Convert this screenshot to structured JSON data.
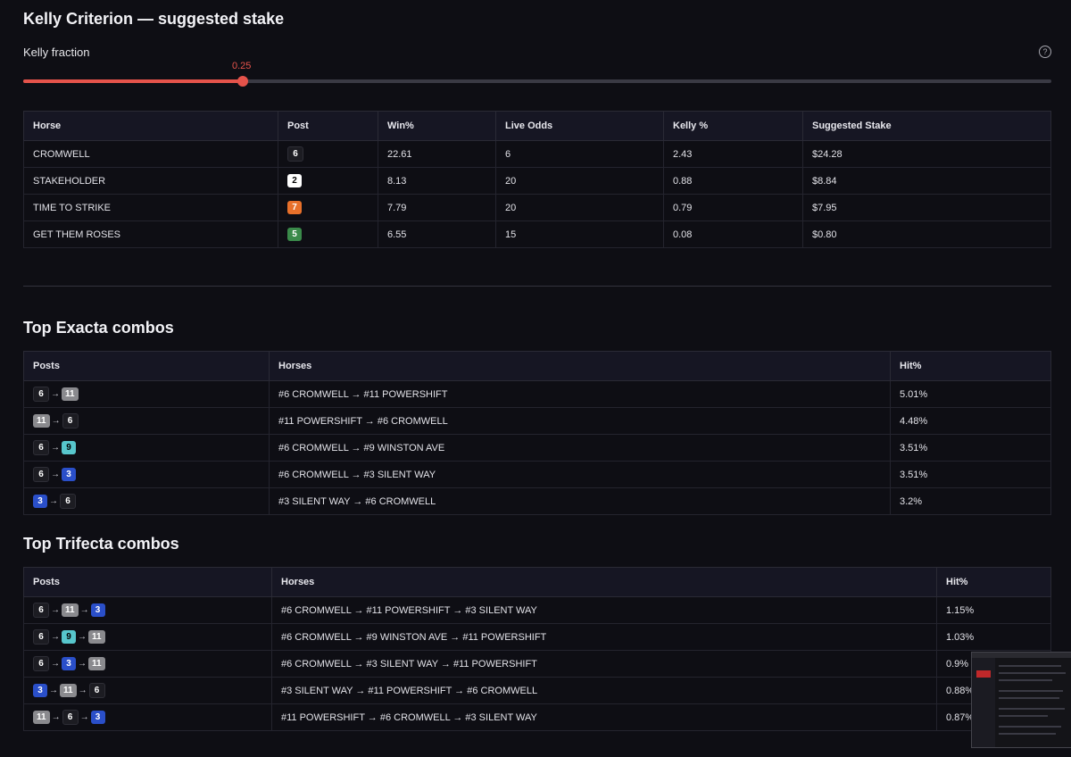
{
  "kelly": {
    "title": "Kelly Criterion — suggested stake",
    "fraction_label": "Kelly fraction",
    "help_icon": "?",
    "fraction_value": "0.25",
    "fraction_level": 0.25,
    "columns": [
      "Horse",
      "Post",
      "Win%",
      "Live Odds",
      "Kelly %",
      "Suggested Stake"
    ],
    "rows": [
      {
        "horse": "CROMWELL",
        "post": "6",
        "win": "22.61",
        "odds": "6",
        "kelly": "2.43",
        "stake": "$24.28"
      },
      {
        "horse": "STAKEHOLDER",
        "post": "2",
        "win": "8.13",
        "odds": "20",
        "kelly": "0.88",
        "stake": "$8.84"
      },
      {
        "horse": "TIME TO STRIKE",
        "post": "7",
        "win": "7.79",
        "odds": "20",
        "kelly": "0.79",
        "stake": "$7.95"
      },
      {
        "horse": "GET THEM ROSES",
        "post": "5",
        "win": "6.55",
        "odds": "15",
        "kelly": "0.08",
        "stake": "$0.80"
      }
    ]
  },
  "exacta": {
    "title": "Top Exacta combos",
    "columns": [
      "Posts",
      "Horses",
      "Hit%"
    ],
    "arrow": "→",
    "rows": [
      {
        "posts": [
          "6",
          "11"
        ],
        "horses": "#6 CROMWELL → #11 POWERSHIFT",
        "hit": "5.01%"
      },
      {
        "posts": [
          "11",
          "6"
        ],
        "horses": "#11 POWERSHIFT → #6 CROMWELL",
        "hit": "4.48%"
      },
      {
        "posts": [
          "6",
          "9"
        ],
        "horses": "#6 CROMWELL → #9 WINSTON AVE",
        "hit": "3.51%"
      },
      {
        "posts": [
          "6",
          "3"
        ],
        "horses": "#6 CROMWELL → #3 SILENT WAY",
        "hit": "3.51%"
      },
      {
        "posts": [
          "3",
          "6"
        ],
        "horses": "#3 SILENT WAY → #6 CROMWELL",
        "hit": "3.2%"
      }
    ]
  },
  "trifecta": {
    "title": "Top Trifecta combos",
    "columns": [
      "Posts",
      "Horses",
      "Hit%"
    ],
    "arrow": "→",
    "rows": [
      {
        "posts": [
          "6",
          "11",
          "3"
        ],
        "horses": "#6 CROMWELL → #11 POWERSHIFT → #3 SILENT WAY",
        "hit": "1.15%"
      },
      {
        "posts": [
          "6",
          "9",
          "11"
        ],
        "horses": "#6 CROMWELL → #9 WINSTON AVE → #11 POWERSHIFT",
        "hit": "1.03%"
      },
      {
        "posts": [
          "6",
          "3",
          "11"
        ],
        "horses": "#6 CROMWELL → #3 SILENT WAY → #11 POWERSHIFT",
        "hit": "0.9%"
      },
      {
        "posts": [
          "3",
          "11",
          "6"
        ],
        "horses": "#3 SILENT WAY → #11 POWERSHIFT → #6 CROMWELL",
        "hit": "0.88%"
      },
      {
        "posts": [
          "11",
          "6",
          "3"
        ],
        "horses": "#11 POWERSHIFT → #6 CROMWELL → #3 SILENT WAY",
        "hit": "0.87%"
      }
    ]
  },
  "post_colors": {
    "2": "#ffffff",
    "3": "#2a4fc9",
    "5": "#3a8a4a",
    "6": "#1c1c22",
    "7": "#e8702a",
    "9": "#57c6cc",
    "11": "#8a8a8e"
  },
  "accent_color": "#e5534b"
}
